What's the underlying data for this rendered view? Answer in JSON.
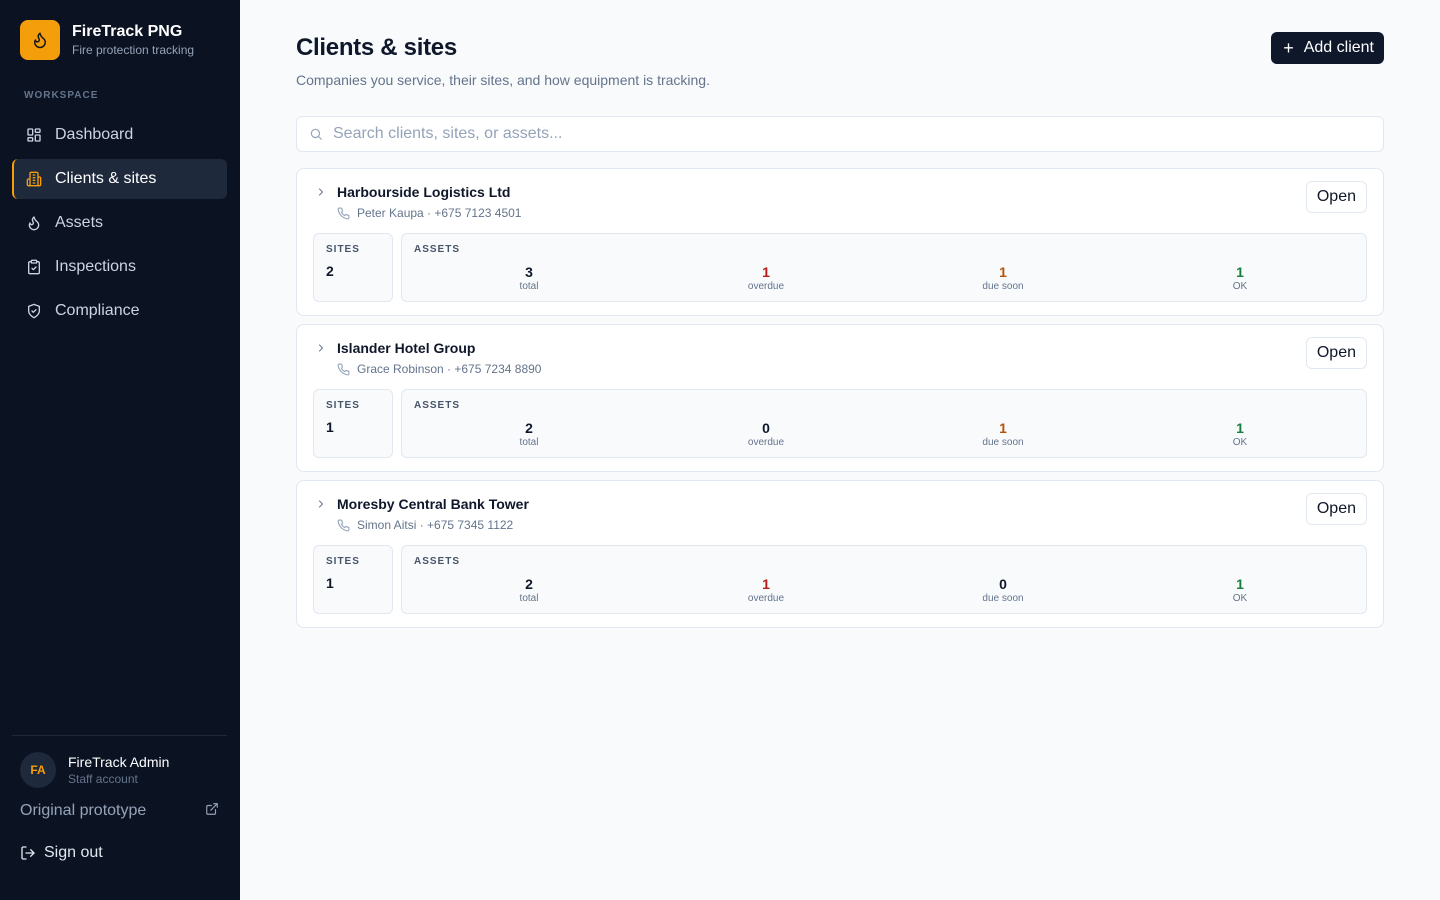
{
  "brand": {
    "title": "FireTrack PNG",
    "subtitle": "Fire protection tracking"
  },
  "sidebar": {
    "section_label": "WORKSPACE",
    "items": [
      {
        "label": "Dashboard",
        "icon": "dashboard-icon",
        "active": false
      },
      {
        "label": "Clients & sites",
        "icon": "building-icon",
        "active": true
      },
      {
        "label": "Assets",
        "icon": "flame-icon",
        "active": false
      },
      {
        "label": "Inspections",
        "icon": "clipboard-icon",
        "active": false
      },
      {
        "label": "Compliance",
        "icon": "shield-icon",
        "active": false
      }
    ],
    "user": {
      "initials": "FA",
      "name": "FireTrack Admin",
      "role": "Staff account"
    },
    "prototype_link": "Original prototype",
    "sign_out": "Sign out"
  },
  "header": {
    "title": "Clients & sites",
    "subtitle": "Companies you service, their sites, and how equipment is tracking.",
    "add_button": "Add client"
  },
  "search": {
    "placeholder": "Search clients, sites, or assets..."
  },
  "labels": {
    "sites": "SITES",
    "assets": "ASSETS",
    "total": "total",
    "overdue": "overdue",
    "due_soon": "due soon",
    "ok": "OK",
    "open": "Open"
  },
  "clients": [
    {
      "name": "Harbourside Logistics Ltd",
      "contact": "Peter Kaupa · +675 7123 4501",
      "sites": "2",
      "total": "3",
      "overdue": "1",
      "due_soon": "1",
      "ok": "1"
    },
    {
      "name": "Islander Hotel Group",
      "contact": "Grace Robinson · +675 7234 8890",
      "sites": "1",
      "total": "2",
      "overdue": "0",
      "due_soon": "1",
      "ok": "1"
    },
    {
      "name": "Moresby Central Bank Tower",
      "contact": "Simon Aitsi · +675 7345 1122",
      "sites": "1",
      "total": "2",
      "overdue": "1",
      "due_soon": "0",
      "ok": "1"
    }
  ],
  "colors": {
    "accent": "#f59e0b",
    "sidebar_bg": "#0b1222",
    "overdue": "#b91c1c",
    "due_soon": "#b45309",
    "ok": "#15803d"
  }
}
